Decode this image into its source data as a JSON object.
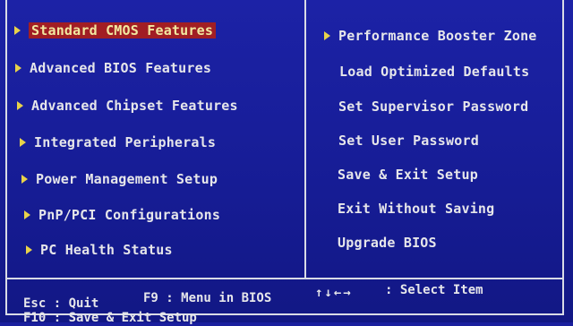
{
  "left_menu": [
    {
      "label": "Standard CMOS Features",
      "selected": true
    },
    {
      "label": "Advanced BIOS Features"
    },
    {
      "label": "Advanced Chipset Features"
    },
    {
      "label": "Integrated Peripherals"
    },
    {
      "label": "Power Management Setup"
    },
    {
      "label": "PnP/PCI Configurations"
    },
    {
      "label": "PC Health Status"
    }
  ],
  "right_menu": [
    {
      "label": "Performance Booster Zone",
      "has_arrow": true
    },
    {
      "label": "Load Optimized Defaults"
    },
    {
      "label": "Set Supervisor Password"
    },
    {
      "label": "Set User Password"
    },
    {
      "label": "Save & Exit Setup"
    },
    {
      "label": "Exit Without Saving"
    },
    {
      "label": "Upgrade BIOS"
    }
  ],
  "status_bar": {
    "esc": "Esc : Quit",
    "f9": "F9 : Menu in BIOS",
    "arrows": "↑↓←→",
    "select": ": Select Item",
    "f10": "F10 : Save & Exit Setup"
  },
  "colors": {
    "background": "#1a1f9e",
    "highlight": "#a11e24",
    "arrow": "#e8d24a",
    "text": "#e6e6ea"
  }
}
